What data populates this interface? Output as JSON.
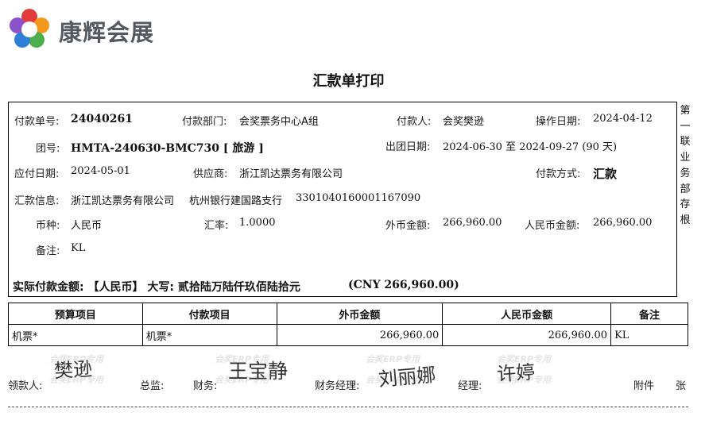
{
  "logo": {
    "text": "康辉会展",
    "icon": "flower-logo-icon",
    "colors": [
      "#e23b3b",
      "#f39a1e",
      "#4cae4c",
      "#2f7fd8",
      "#8b52c9"
    ]
  },
  "title": "汇款单打印",
  "fields": {
    "pay_no_label": "付款单号:",
    "pay_no": "24040261",
    "dept_label": "付款部门:",
    "dept": "会奖票务中心A组",
    "payer_label": "付款人:",
    "payer": "会奖樊逊",
    "op_date_label": "操作日期:",
    "op_date": "2024-04-12",
    "group_label": "团号:",
    "group": "HMTA-240630-BMC730 [ 旅游 ]",
    "tour_date_label": "出团日期:",
    "tour_date": "2024-06-30 至 2024-09-27 (90 天)",
    "due_date_label": "应付日期:",
    "due_date": "2024-05-01",
    "supplier_label": "供应商:",
    "supplier": "浙江凯达票务有限公司",
    "method_label": "付款方式:",
    "method": "汇款",
    "remit_label": "汇款信息:",
    "remit_company": "浙江凯达票务有限公司",
    "remit_bank": "杭州银行建国路支行",
    "remit_account": "3301040160001167090",
    "currency_label": "币种:",
    "currency": "人民币",
    "rate_label": "汇率:",
    "rate": "1.0000",
    "foreign_amount_label": "外币金额:",
    "foreign_amount": "266,960.00",
    "rmb_amount_label": "人民币金额:",
    "rmb_amount": "266,960.00",
    "note_label": "备注:",
    "note": "KL",
    "actual_amount_text": "实际付款金额: 【人民币】 大写: 贰拾陆万陆仟玖佰陆拾元",
    "actual_amount_cny": "(CNY 266,960.00)"
  },
  "sidebar_text": [
    "第",
    "一",
    "联",
    "业",
    "务",
    "部",
    "存",
    "根"
  ],
  "table": {
    "headers": [
      "预算项目",
      "付款项目",
      "外币金额",
      "人民币金额",
      "备注"
    ],
    "rows": [
      [
        "机票*",
        "机票*",
        "266,960.00",
        "266,960.00",
        "KL"
      ]
    ]
  },
  "footer": {
    "payee_label": "领款人:",
    "director_label": "总监:",
    "finance_label": "财务:",
    "finance_manager_label": "财务经理:",
    "manager_label": "经理:",
    "attachment_label": "附件",
    "sheet_label": "张",
    "sig_payee": "樊逊",
    "sig_finance": "王宝静",
    "sig_finance_manager": "刘丽娜",
    "sig_manager": "许婷",
    "watermark": "会奖ERP专用"
  }
}
